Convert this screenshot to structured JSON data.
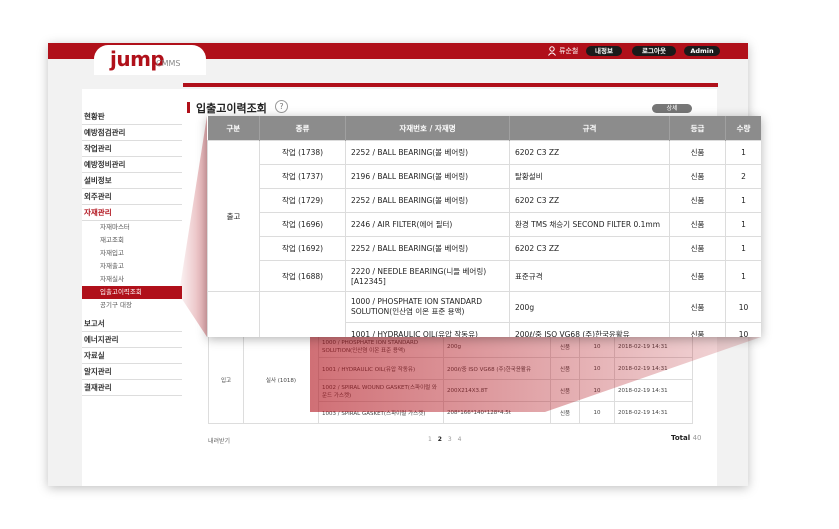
{
  "header": {
    "logo": "jump",
    "logo_sub": "CMMS",
    "user_icon": "user-icon",
    "user_name": "류순철",
    "buttons": [
      "내정보",
      "로그아웃",
      "Admin"
    ]
  },
  "sidebar": {
    "items": [
      {
        "label": "현황판"
      },
      {
        "label": "예방점검관리"
      },
      {
        "label": "작업관리"
      },
      {
        "label": "예방정비관리"
      },
      {
        "label": "설비정보"
      },
      {
        "label": "외주관리"
      },
      {
        "label": "자재관리",
        "active": true
      }
    ],
    "subitems": [
      "자재마스터",
      "재고조회",
      "자재입고",
      "자재출고",
      "자재실사",
      "입출고이력조회",
      "공기구 대장"
    ],
    "items_after": [
      "보고서",
      "에너지관리",
      "자료실",
      "알지관리",
      "결재관리"
    ]
  },
  "page": {
    "title": "입출고이력조회",
    "help_icon": "question-icon",
    "detail_button": "상세"
  },
  "panel": {
    "columns": [
      "구분",
      "종류",
      "자재번호 / 자재명",
      "규격",
      "등급",
      "수량"
    ],
    "group_label": "출고",
    "rows": [
      {
        "kind": "작업 (1738)",
        "item": "2252 / BALL BEARING(볼 베어링)",
        "spec": "6202 C3 ZZ",
        "grade": "신품",
        "qty": "1"
      },
      {
        "kind": "작업 (1737)",
        "item": "2196 / BALL BEARING(볼 베어링)",
        "spec": "탈황설비",
        "grade": "신품",
        "qty": "2"
      },
      {
        "kind": "작업 (1729)",
        "item": "2252 / BALL BEARING(볼 베어링)",
        "spec": "6202 C3 ZZ",
        "grade": "신품",
        "qty": "1"
      },
      {
        "kind": "작업 (1696)",
        "item": "2246 / AIR FILTER(에어 필터)",
        "spec": "환경 TMS 채승기 SECOND FILTER 0.1mm",
        "grade": "신품",
        "qty": "1"
      },
      {
        "kind": "작업 (1692)",
        "item": "2252 / BALL BEARING(볼 베어링)",
        "spec": "6202 C3 ZZ",
        "grade": "신품",
        "qty": "1"
      },
      {
        "kind": "작업 (1688)",
        "item": "2220 / NEEDLE BEARING(니들 베어링) [A12345]",
        "spec": "표준규격",
        "grade": "신품",
        "qty": "1"
      }
    ],
    "extra_row": {
      "item": "1000 / PHOSPHATE ION STANDARD SOLUTION(인산염 이온 표준 용액)",
      "spec": "200g",
      "grade": "신품",
      "qty": "10"
    },
    "cut_row": {
      "item": "1001 / HYDRAULIC OIL(유압 작동유)",
      "spec": "200ℓ/중 ISO VG68 (주)한국윤활유",
      "grade": "신품",
      "qty": "10"
    }
  },
  "bottom": {
    "group_label": "입고",
    "kind": "실사 (1018)",
    "rows": [
      {
        "item": "1000 / PHOSPHATE ION STANDARD SOLUTION(인산염 이온 표준 용액)",
        "spec": "200g",
        "grade": "신품",
        "qty": "10",
        "date": "2018-02-19 14:31"
      },
      {
        "item": "1001 / HYDRAULIC OIL(유압 작동유)",
        "spec": "200ℓ/중 ISO VG68 (주)한국윤활유",
        "grade": "신품",
        "qty": "10",
        "date": "2018-02-19 14:31"
      },
      {
        "item": "1002 / SPIRAL WOUND GASKET(스파이럴 와운드 가스켓)",
        "spec": "200X214X3.8T",
        "grade": "신품",
        "qty": "10",
        "date": "2018-02-19 14:31"
      },
      {
        "item": "1003 / SPIRAL GASKET(스파이럴 가스켓)",
        "spec": "208*166*140*128*4.5t",
        "grade": "신품",
        "qty": "10",
        "date": "2018-02-19 14:31"
      }
    ],
    "excel_label": "내려받기",
    "pages": [
      "1",
      "2",
      "3",
      "4"
    ],
    "current_page": "2",
    "total_label": "Total",
    "total_value": "40"
  },
  "colors": {
    "accent": "#b0101a",
    "header_gray": "#8c8c8c"
  }
}
